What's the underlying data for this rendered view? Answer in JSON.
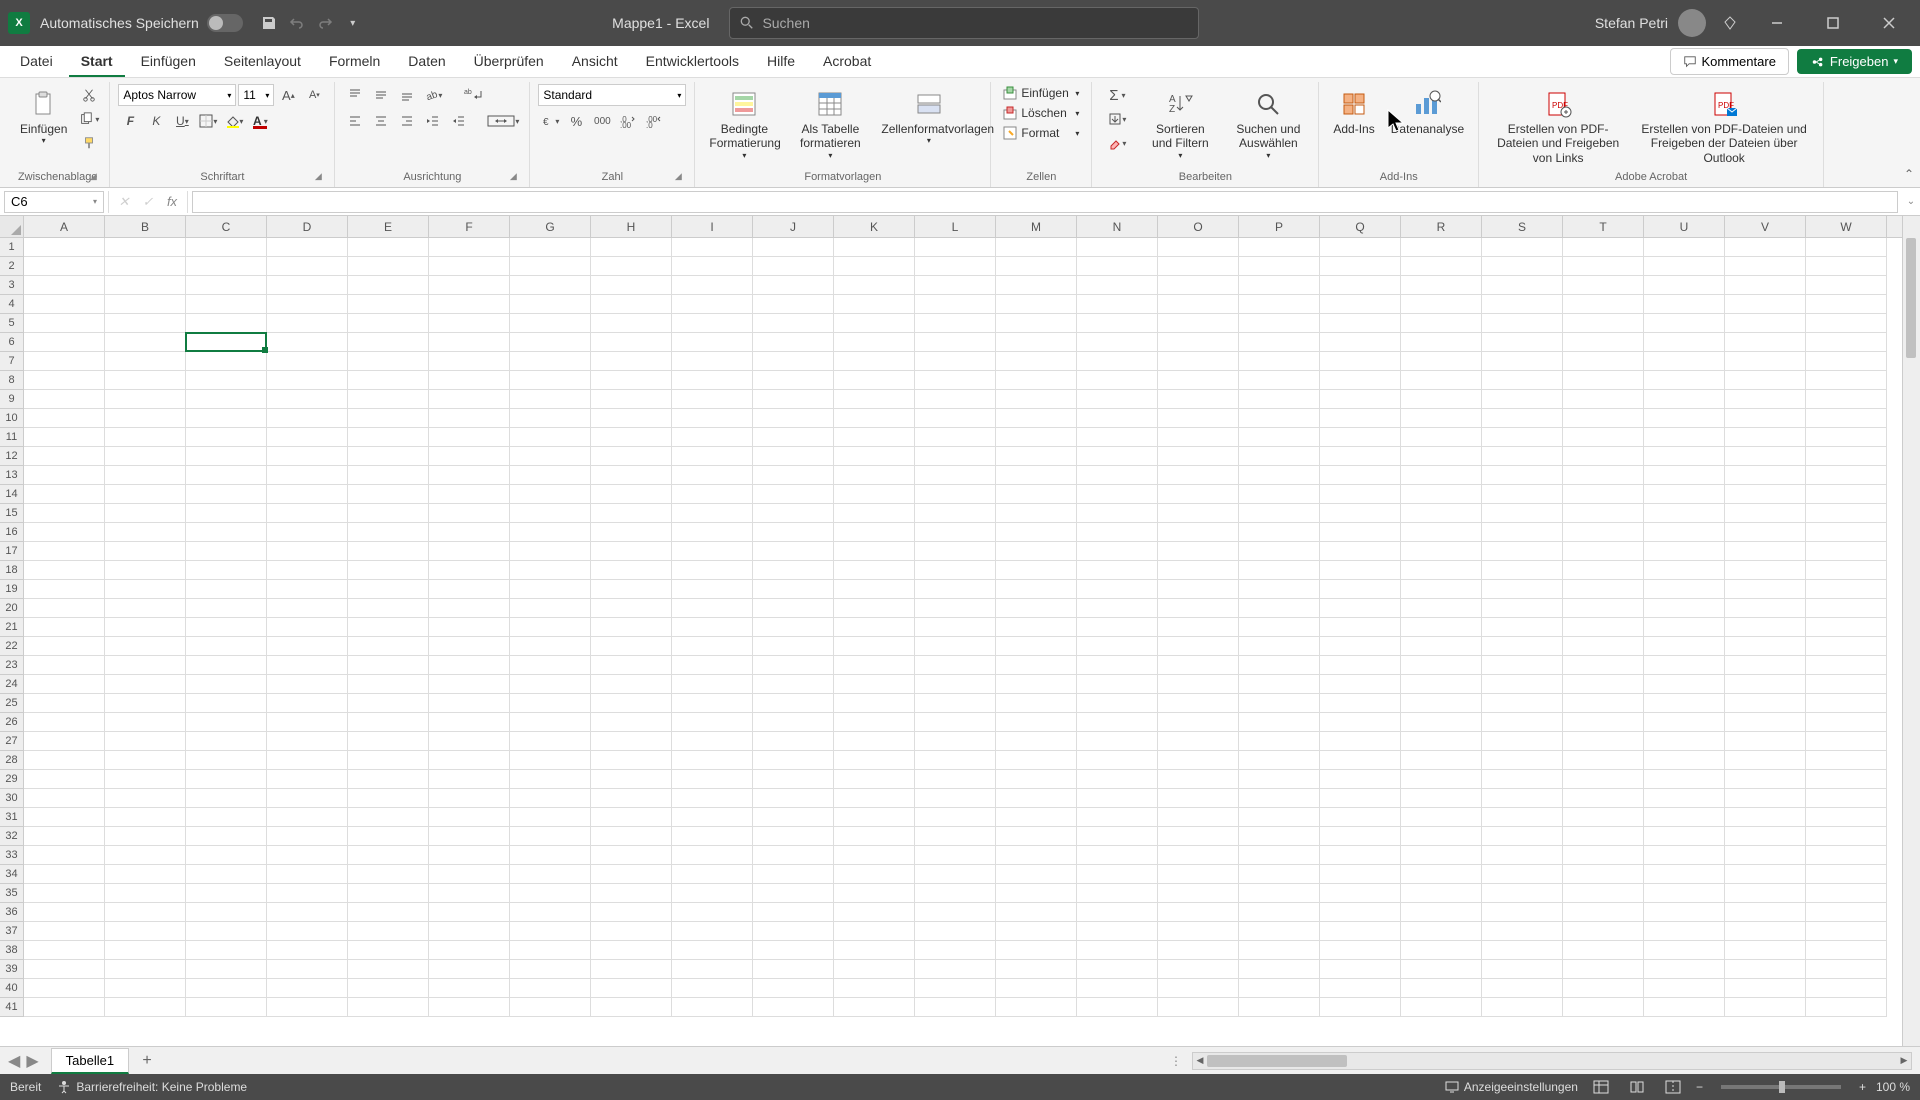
{
  "titlebar": {
    "autosave_label": "Automatisches Speichern",
    "doc_title": "Mappe1  -  Excel",
    "search_placeholder": "Suchen",
    "user_name": "Stefan Petri"
  },
  "tabs": {
    "items": [
      "Datei",
      "Start",
      "Einfügen",
      "Seitenlayout",
      "Formeln",
      "Daten",
      "Überprüfen",
      "Ansicht",
      "Entwicklertools",
      "Hilfe",
      "Acrobat"
    ],
    "active_index": 1,
    "kommentare": "Kommentare",
    "freigeben": "Freigeben"
  },
  "ribbon": {
    "clipboard": {
      "paste": "Einfügen",
      "label": "Zwischenablage"
    },
    "font": {
      "name": "Aptos Narrow",
      "size": "11",
      "label": "Schriftart"
    },
    "align": {
      "label": "Ausrichtung"
    },
    "number": {
      "format": "Standard",
      "label": "Zahl"
    },
    "styles": {
      "cond": "Bedingte Formatierung",
      "table": "Als Tabelle formatieren",
      "cellstyles": "Zellenformatvorlagen",
      "label": "Formatvorlagen"
    },
    "cells": {
      "insert": "Einfügen",
      "delete": "Löschen",
      "format": "Format",
      "label": "Zellen"
    },
    "editing": {
      "sort": "Sortieren und Filtern",
      "find": "Suchen und Auswählen",
      "label": "Bearbeiten"
    },
    "addins": {
      "addins": "Add-Ins",
      "analyse": "Datenanalyse",
      "label": "Add-Ins"
    },
    "acrobat": {
      "pdf1": "Erstellen von PDF-Dateien und Freigeben von Links",
      "pdf2": "Erstellen von PDF-Dateien und Freigeben der Dateien über Outlook",
      "label": "Adobe Acrobat"
    }
  },
  "namebox": "C6",
  "columns": [
    "A",
    "B",
    "C",
    "D",
    "E",
    "F",
    "G",
    "H",
    "I",
    "J",
    "K",
    "L",
    "M",
    "N",
    "O",
    "P",
    "Q",
    "R",
    "S",
    "T",
    "U",
    "V",
    "W"
  ],
  "active_cell": {
    "col": 2,
    "row": 5
  },
  "sheet": {
    "tab1": "Tabelle1"
  },
  "status": {
    "ready": "Bereit",
    "accessibility": "Barrierefreiheit: Keine Probleme",
    "display_settings": "Anzeigeeinstellungen",
    "zoom": "100 %"
  }
}
